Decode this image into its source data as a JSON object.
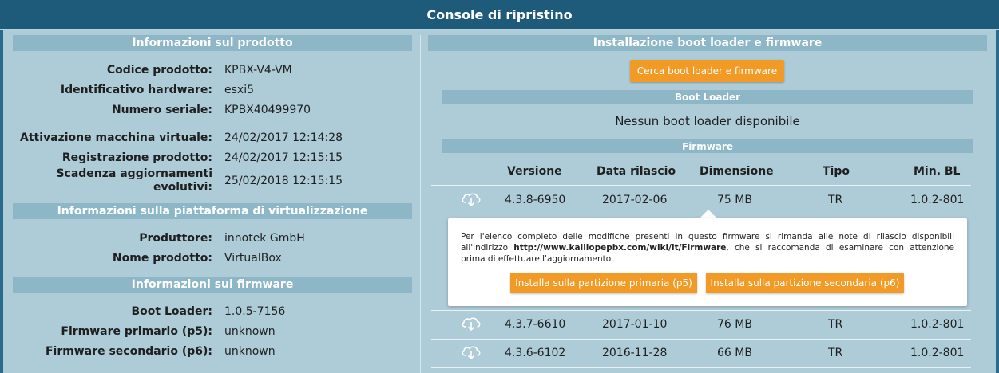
{
  "window": {
    "title": "Console di ripristino"
  },
  "left": {
    "product_info": {
      "title": "Informazioni sul prodotto",
      "rows": [
        {
          "label": "Codice prodotto:",
          "value": "KPBX-V4-VM"
        },
        {
          "label": "Identificativo hardware:",
          "value": "esxi5"
        },
        {
          "label": "Numero seriale:",
          "value": "KPBX40499970"
        },
        {
          "label": "Attivazione macchina virtuale:",
          "value": "24/02/2017 12:14:28"
        },
        {
          "label": "Registrazione prodotto:",
          "value": "24/02/2017 12:15:15"
        },
        {
          "label_line1": "Scadenza aggiornamenti",
          "label_line2": "evolutivi:",
          "value": "25/02/2018 12:15:15"
        }
      ]
    },
    "virt_info": {
      "title": "Informazioni sulla piattaforma di virtualizzazione",
      "rows": [
        {
          "label": "Produttore:",
          "value": "innotek GmbH"
        },
        {
          "label": "Nome prodotto:",
          "value": "VirtualBox"
        }
      ]
    },
    "firmware_info": {
      "title": "Informazioni sul firmware",
      "rows": [
        {
          "label": "Boot Loader:",
          "value": "1.0.5-7156"
        },
        {
          "label": "Firmware primario (p5):",
          "value": "unknown"
        },
        {
          "label": "Firmware secondario (p6):",
          "value": "unknown"
        }
      ]
    }
  },
  "right": {
    "title": "Installazione boot loader e firmware",
    "search_button": "Cerca boot loader e firmware",
    "boot_loader": {
      "title": "Boot Loader",
      "empty_text": "Nessun boot loader disponibile"
    },
    "firmware": {
      "title": "Firmware",
      "columns": [
        "Versione",
        "Data rilascio",
        "Dimensione",
        "Tipo",
        "Min. BL"
      ],
      "rows": [
        {
          "version": "4.3.8-6950",
          "date": "2017-02-06",
          "size": "75 MB",
          "type": "TR",
          "min_bl": "1.0.2-801"
        },
        {
          "version": "4.3.7-6610",
          "date": "2017-01-10",
          "size": "76 MB",
          "type": "TR",
          "min_bl": "1.0.2-801"
        },
        {
          "version": "4.3.6-6102",
          "date": "2016-11-28",
          "size": "66 MB",
          "type": "TR",
          "min_bl": "1.0.2-801"
        }
      ],
      "download_icon": "cloud-download-icon"
    },
    "popup": {
      "text_line1": "Per l'elenco completo delle modifiche presenti in questo firmware si rimanda alle note di rilascio disponibili",
      "text_line2_pre": "all'indirizzo ",
      "link": "http://www.kalliopepbx.com/wiki/it/Firmware",
      "text_line2_post": ", che si raccomanda di esaminare con attenzione",
      "text_line3": "prima di effettuare l'aggiornamento.",
      "install_primary": "Installa sulla partizione primaria (p5)",
      "install_secondary": "Installa sulla partizione secondaria (p6)"
    }
  },
  "colors": {
    "title_bar": "#1e5a7a",
    "background": "#aecbd8",
    "section": "#8db6c6",
    "accent_button": "#f29a26"
  }
}
